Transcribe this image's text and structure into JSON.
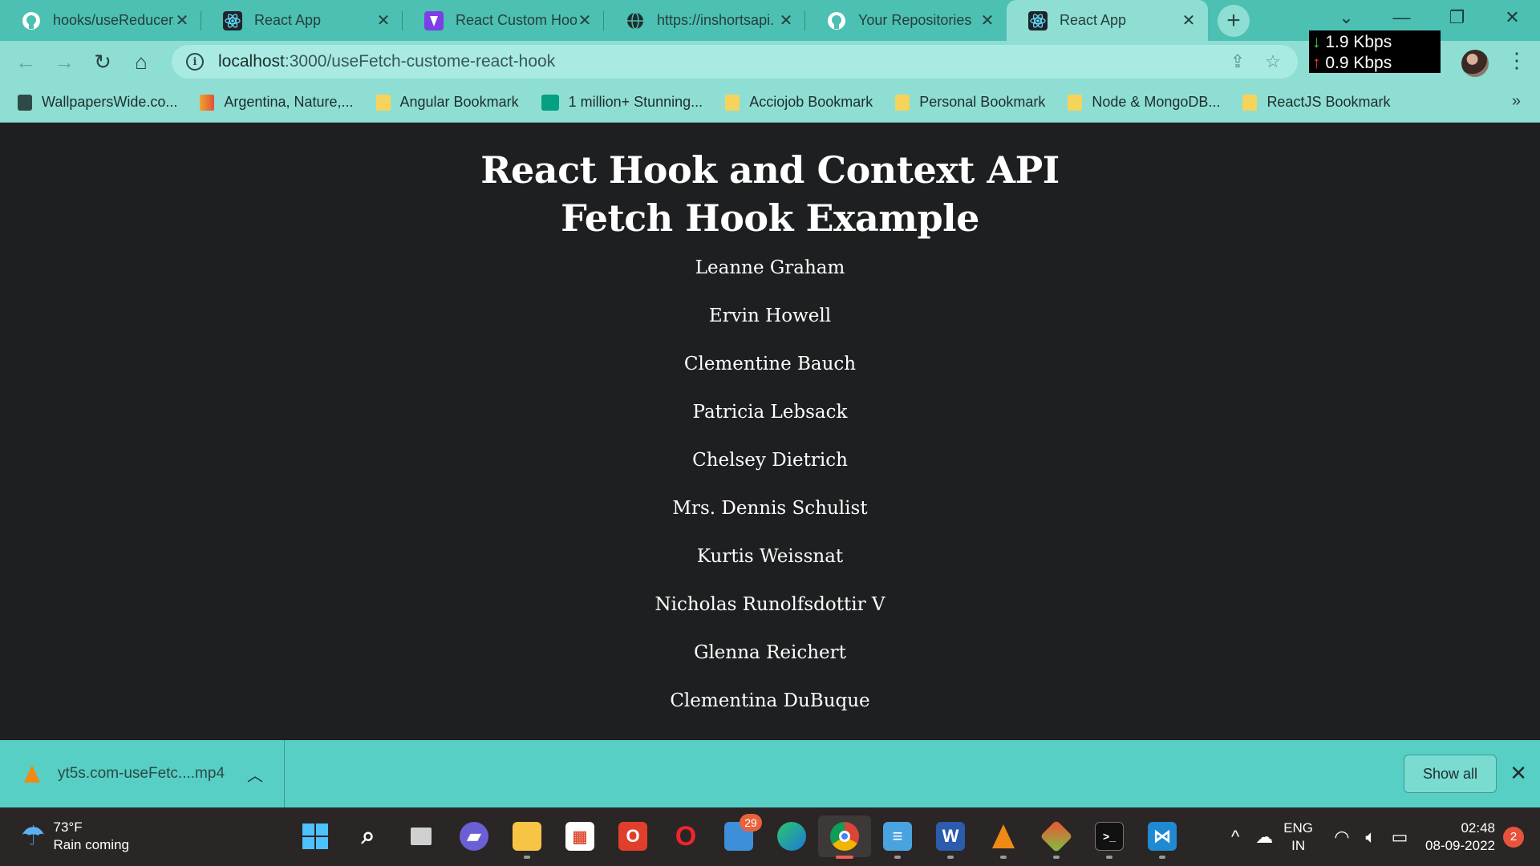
{
  "browser": {
    "tabs": [
      {
        "title": "hooks/useReducer.j",
        "icon": "github-icon"
      },
      {
        "title": "React App",
        "icon": "react-icon"
      },
      {
        "title": "React Custom Hool",
        "icon": "vite-icon"
      },
      {
        "title": "https://inshortsapi.",
        "icon": "globe-icon"
      },
      {
        "title": "Your Repositories",
        "icon": "github-icon"
      },
      {
        "title": "React App",
        "icon": "react-icon",
        "active": true
      }
    ],
    "url_host": "localhost",
    "url_path": ":3000/useFetch-custome-react-hook",
    "net_down": "1.9 Kbps",
    "net_up": "0.9 Kbps",
    "bookmarks": [
      "WallpapersWide.co...",
      "Argentina, Nature,...",
      "Angular Bookmark",
      "1 million+ Stunning...",
      "Acciojob Bookmark",
      "Personal Bookmark",
      "Node & MongoDB...",
      "ReactJS Bookmark"
    ],
    "bookmark_more": "»"
  },
  "page": {
    "title_line1": "React Hook and Context API",
    "title_line2": "Fetch Hook Example",
    "users": [
      "Leanne Graham",
      "Ervin Howell",
      "Clementine Bauch",
      "Patricia Lebsack",
      "Chelsey Dietrich",
      "Mrs. Dennis Schulist",
      "Kurtis Weissnat",
      "Nicholas Runolfsdottir V",
      "Glenna Reichert",
      "Clementina DuBuque"
    ]
  },
  "downloads": {
    "file_name": "yt5s.com-useFetc....mp4",
    "show_all": "Show all"
  },
  "taskbar": {
    "temperature": "73°F",
    "weather_text": "Rain coming",
    "teams_badge": "29",
    "lang_line1": "ENG",
    "lang_line2": "IN",
    "time": "02:48",
    "date": "08-09-2022",
    "notifications": "2"
  },
  "colors": {
    "chrome_tabbar": "#4cc0b3",
    "chrome_toolbar": "#8fded3",
    "page_background": "#1e1f20",
    "download_bar": "#57cfc5",
    "taskbar": "#2a2626"
  }
}
